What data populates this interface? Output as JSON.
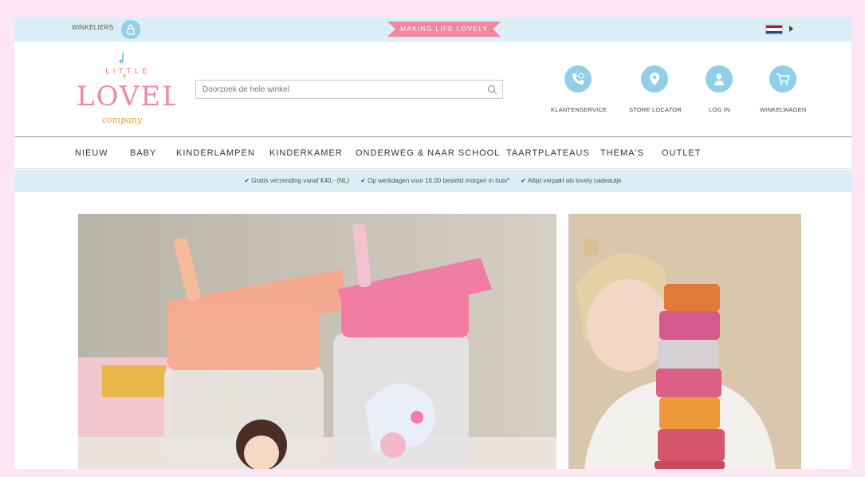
{
  "topbar": {
    "dealers_label": "WINKELIERS",
    "tagline": "MAKING LIFE LOVELY"
  },
  "logo": {
    "line1": "LITTLE",
    "line2": "LOVELY",
    "line3": "company"
  },
  "search": {
    "placeholder": "Doorzoek de hele winkel"
  },
  "header_links": [
    {
      "label": "KLANTENSERVICE",
      "icon": "phone-icon"
    },
    {
      "label": "STORE LOCATOR",
      "icon": "map-pin-icon"
    },
    {
      "label": "LOG IN",
      "icon": "user-icon"
    },
    {
      "label": "WINKELWAGEN",
      "icon": "cart-icon"
    }
  ],
  "nav": [
    "NIEUW",
    "BABY",
    "KINDERLAMPEN",
    "KINDERKAMER",
    "ONDERWEG & NAAR SCHOOL",
    "TAARTPLATEAUS",
    "THEMA'S",
    "OUTLET"
  ],
  "usp": [
    "✔ Gratis verzending vanaf €40,- (NL)",
    "✔ Op werkdagen voor 16.00 besteld morgen in huis*",
    "✔ Altijd verpakt als lovely cadeautje"
  ],
  "colors": {
    "page_bg": "#fde6f3",
    "bar_bg": "#d9eef5",
    "icon_blue": "#8fd0e8",
    "tagline_pink": "#f3879f"
  }
}
